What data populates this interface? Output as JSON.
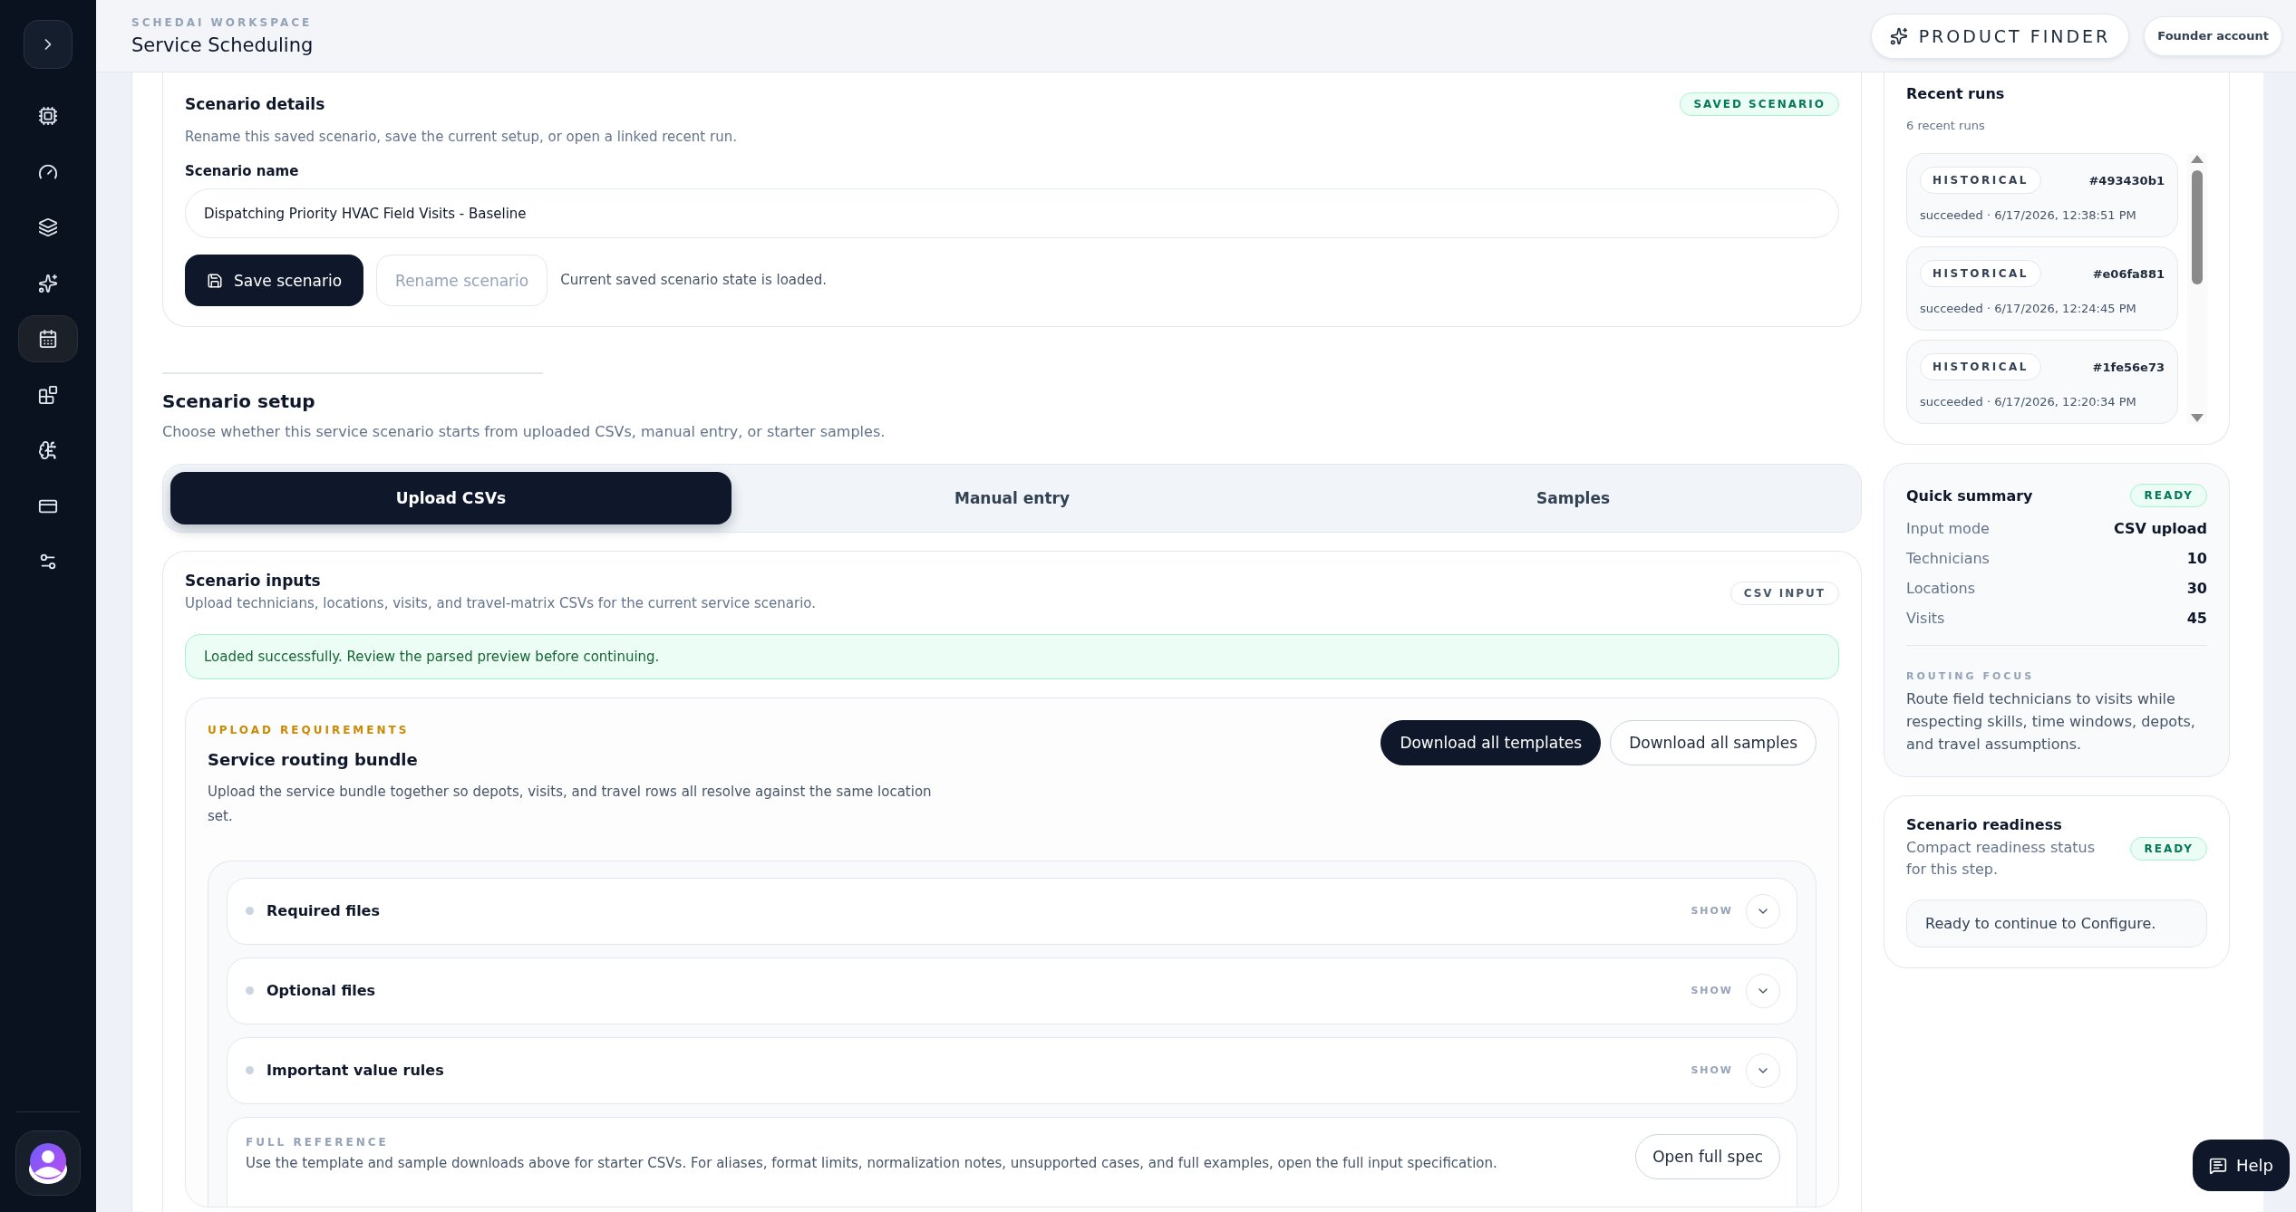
{
  "sidebar": {
    "items": [
      {
        "selected": false
      },
      {
        "selected": false
      },
      {
        "selected": false
      },
      {
        "selected": false
      },
      {
        "selected": true
      },
      {
        "selected": false
      },
      {
        "selected": false
      },
      {
        "selected": false
      },
      {
        "selected": false
      }
    ]
  },
  "header": {
    "eyebrow": "SCHEDAI WORKSPACE",
    "title": "Service Scheduling",
    "product_finder": "PRODUCT FINDER",
    "account": "Founder account"
  },
  "scenario_details": {
    "title": "Scenario details",
    "subtitle": "Rename this saved scenario, save the current setup, or open a linked recent run.",
    "badge": "SAVED SCENARIO",
    "name_label": "Scenario name",
    "name_value": "Dispatching Priority HVAC Field Visits - Baseline",
    "save_button": "Save scenario",
    "rename_button": {
      "label": "Rename scenario",
      "disabled": true
    },
    "status": "Current saved scenario state is loaded."
  },
  "scenario_setup": {
    "title": "Scenario setup",
    "subtitle": "Choose whether this service scenario starts from uploaded CSVs, manual entry, or starter samples.",
    "tabs": [
      {
        "label": "Upload CSVs",
        "selected": true
      },
      {
        "label": "Manual entry",
        "selected": false
      },
      {
        "label": "Samples",
        "selected": false
      }
    ]
  },
  "scenario_inputs": {
    "title": "Scenario inputs",
    "subtitle": "Upload technicians, locations, visits, and travel-matrix CSVs for the current service scenario.",
    "badge": "CSV INPUT",
    "alert": "Loaded successfully. Review the parsed preview before continuing.",
    "requirements": {
      "eyebrow": "UPLOAD REQUIREMENTS",
      "title": "Service routing bundle",
      "description": "Upload the service bundle together so depots, visits, and travel rows all resolve against the same location set.",
      "buttons": [
        {
          "label": "Download all templates",
          "primary": true
        },
        {
          "label": "Download all samples",
          "primary": false
        }
      ],
      "sections": [
        {
          "label": "Required files",
          "action": "SHOW",
          "expanded": false
        },
        {
          "label": "Optional files",
          "action": "SHOW",
          "expanded": false
        },
        {
          "label": "Important value rules",
          "action": "SHOW",
          "expanded": false
        }
      ],
      "reference": {
        "eyebrow": "FULL REFERENCE",
        "text": "Use the template and sample downloads above for starter CSVs. For aliases, format limits, normalization notes, unsupported cases, and full examples, open the full input specification.",
        "button": "Open full spec"
      }
    }
  },
  "recent_runs": {
    "title": "Recent runs",
    "count": "6 recent runs",
    "runs": [
      {
        "tag": "HISTORICAL",
        "id": "#493430b1",
        "status": "succeeded · 6/17/2026, 12:38:51 PM"
      },
      {
        "tag": "HISTORICAL",
        "id": "#e06fa881",
        "status": "succeeded · 6/17/2026, 12:24:45 PM"
      },
      {
        "tag": "HISTORICAL",
        "id": "#1fe56e73",
        "status": "succeeded · 6/17/2026, 12:20:34 PM"
      }
    ]
  },
  "quick_summary": {
    "title": "Quick summary",
    "badge": "READY",
    "rows": [
      {
        "label": "Input mode",
        "value": "CSV upload"
      },
      {
        "label": "Technicians",
        "value": "10"
      },
      {
        "label": "Locations",
        "value": "30"
      },
      {
        "label": "Visits",
        "value": "45"
      }
    ],
    "focus_label": "ROUTING FOCUS",
    "focus_text": "Route field technicians to visits while respecting skills, time windows, depots, and travel assumptions."
  },
  "readiness": {
    "title": "Scenario readiness",
    "subtitle": "Compact readiness status for this step.",
    "badge": "READY",
    "message": "Ready to continue to Configure."
  },
  "help": "Help"
}
